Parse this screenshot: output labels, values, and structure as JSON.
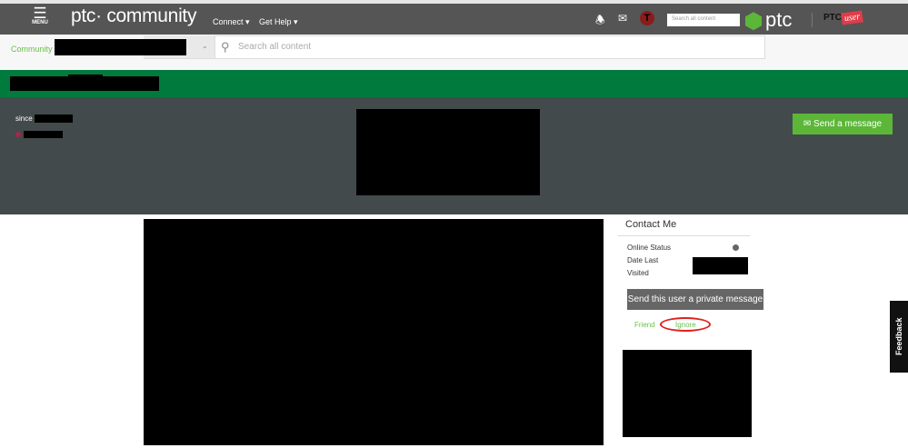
{
  "nav": {
    "menu_label": "MENU",
    "logo": "ptc· community",
    "connect": "Connect ▾",
    "get_help": "Get Help ▾",
    "search_placeholder": "Search all content",
    "ptc_logo": "ptc",
    "ptc_user_logo": "PTC",
    "ptc_user_logo_badge": "user"
  },
  "subnav": {
    "community": "Community",
    "search_placeholder": "Search all content"
  },
  "profile": {
    "since_label": "since",
    "send_message": "Send a message"
  },
  "contact": {
    "title": "Contact Me",
    "online_status": "Online Status",
    "date_last": "Date Last",
    "visited": "Visited",
    "private_message": "Send this user a private message",
    "friend": "Friend",
    "ignore": "Ignore"
  },
  "feedback": "Feedback",
  "colors": {
    "brand_green": "#007a3d",
    "accent_green": "#5cb738",
    "highlight": "#e02020"
  }
}
